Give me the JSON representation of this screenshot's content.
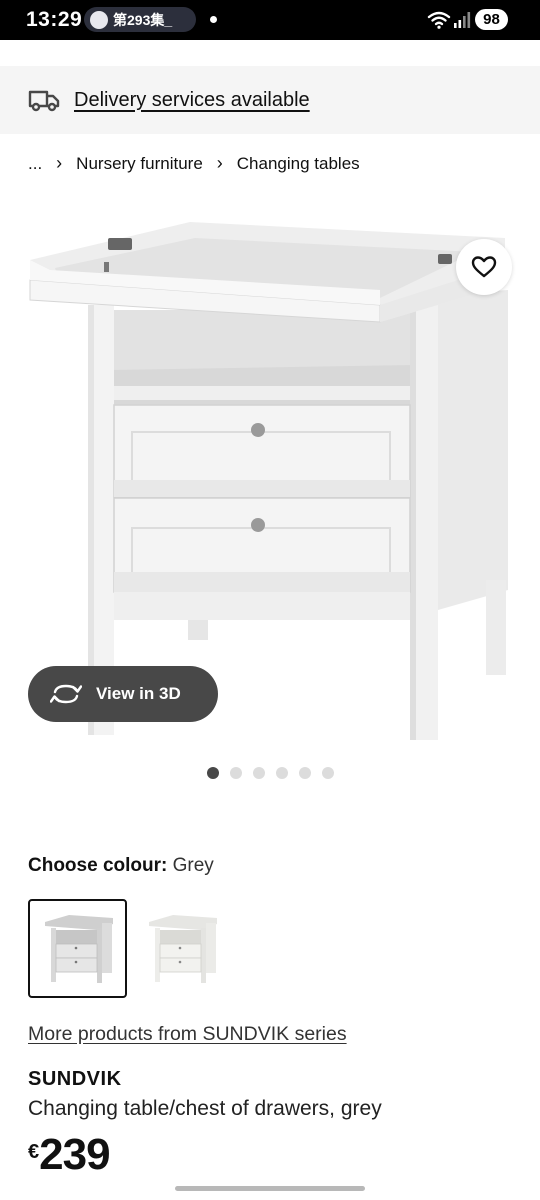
{
  "status_bar": {
    "time": "13:29",
    "notification_pill": "第293集_",
    "battery": "98",
    "icons": [
      "wifi-icon",
      "signal-icon",
      "battery-icon"
    ]
  },
  "delivery": {
    "icon": "truck-icon",
    "text": "Delivery services available"
  },
  "breadcrumb": {
    "ellipsis": "...",
    "items": [
      "Nursery furniture",
      "Changing tables"
    ],
    "separator": "›"
  },
  "gallery": {
    "favourite_icon": "heart-icon",
    "view3d_icon": "rotate-icon",
    "view3d_label": "View in 3D",
    "dot_count": 6,
    "active_dot": 1
  },
  "colour": {
    "label": "Choose colour:",
    "value": "Grey",
    "swatches": [
      "Grey",
      "White"
    ],
    "selected": "Grey"
  },
  "series_link": "More products from SUNDVIK series",
  "product": {
    "name": "SUNDVIK",
    "description": "Changing table/chest of drawers, grey",
    "currency": "€",
    "price": "239"
  },
  "colors": {
    "button_dark": "#484848",
    "banner_bg": "#f5f5f5",
    "furniture": "#f2f2f2"
  }
}
